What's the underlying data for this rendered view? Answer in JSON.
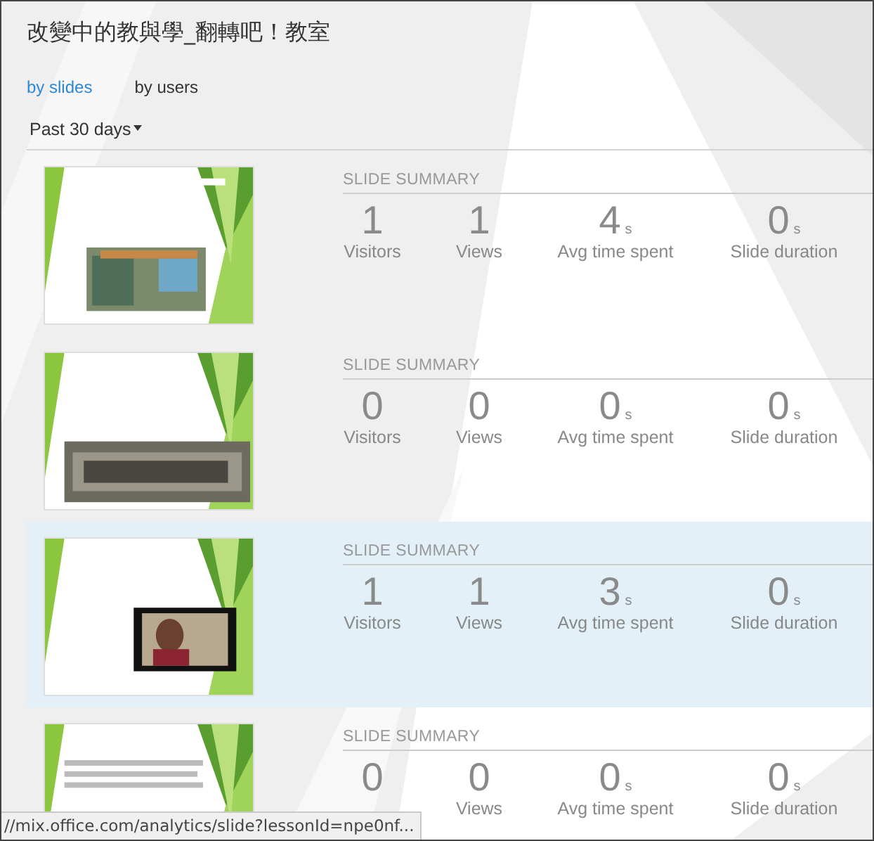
{
  "title": "改變中的教與學_翻轉吧！教室",
  "tabs": [
    {
      "label": "by slides",
      "selected": true
    },
    {
      "label": "by users",
      "selected": false
    }
  ],
  "period": {
    "label": "Past 30 days"
  },
  "slides": [
    {
      "selected": false,
      "summary_title": "SLIDE SUMMARY",
      "stats": [
        {
          "value": "1",
          "label": "Visitors"
        },
        {
          "value": "1",
          "label": "Views"
        },
        {
          "value": "4",
          "unit": "s",
          "label": "Avg time spent"
        },
        {
          "value": "0",
          "unit": "s",
          "label": "Slide duration"
        }
      ]
    },
    {
      "selected": false,
      "summary_title": "SLIDE SUMMARY",
      "stats": [
        {
          "value": "0",
          "label": "Visitors"
        },
        {
          "value": "0",
          "label": "Views"
        },
        {
          "value": "0",
          "unit": "s",
          "label": "Avg time spent"
        },
        {
          "value": "0",
          "unit": "s",
          "label": "Slide duration"
        }
      ]
    },
    {
      "selected": true,
      "summary_title": "SLIDE SUMMARY",
      "stats": [
        {
          "value": "1",
          "label": "Visitors"
        },
        {
          "value": "1",
          "label": "Views"
        },
        {
          "value": "3",
          "unit": "s",
          "label": "Avg time spent"
        },
        {
          "value": "0",
          "unit": "s",
          "label": "Slide duration"
        }
      ]
    },
    {
      "selected": false,
      "summary_title": "SLIDE SUMMARY",
      "stats": [
        {
          "value": "0"
        },
        {
          "value": "0",
          "label": "Views"
        },
        {
          "value": "0",
          "unit": "s",
          "label": "Avg time spent"
        },
        {
          "value": "0",
          "unit": "s",
          "label": "Slide duration"
        }
      ]
    }
  ],
  "status_url": "//mix.office.com/analytics/slide?lessonId=npe0nf..."
}
